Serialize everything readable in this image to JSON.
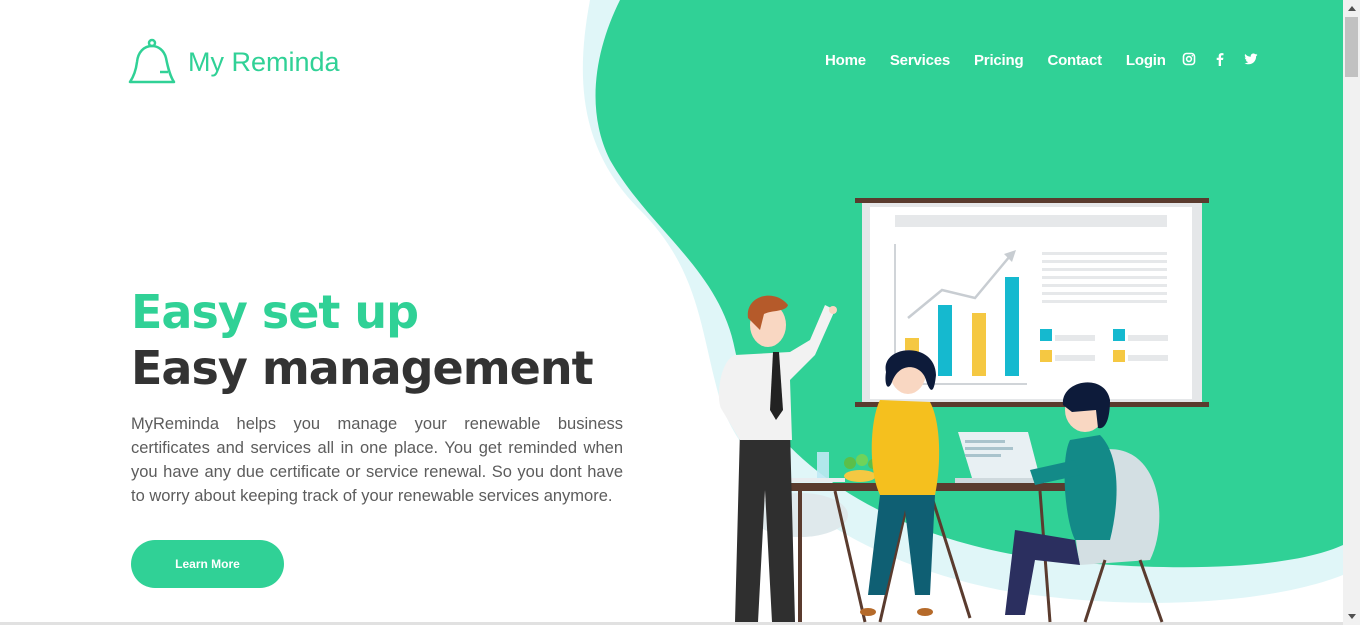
{
  "brand": {
    "name": "My Reminda",
    "icon": "bell-icon"
  },
  "nav": {
    "items": [
      {
        "label": "Home"
      },
      {
        "label": "Services"
      },
      {
        "label": "Pricing"
      },
      {
        "label": "Contact"
      },
      {
        "label": "Login"
      }
    ],
    "social": [
      "instagram-icon",
      "facebook-icon",
      "twitter-icon"
    ]
  },
  "hero": {
    "headline_1": "Easy set up",
    "headline_2": "Easy management",
    "description": "MyReminda helps you manage your renewable business certificates and services all in one place. You get reminded when you have any due certificate or service renewal. So you dont have to worry about keeping track of your renewable services anymore.",
    "cta_label": "Learn More"
  },
  "colors": {
    "accent": "#30d196",
    "heading_dark": "#333333",
    "text": "#5c5c5c",
    "light_blue_blob": "#e0f6f8"
  }
}
